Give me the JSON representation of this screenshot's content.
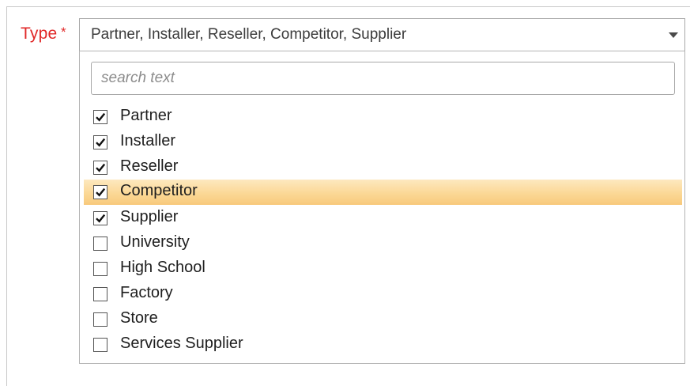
{
  "field": {
    "label": "Type",
    "required_mark": "*",
    "value": "Partner, Installer, Reseller, Competitor, Supplier"
  },
  "search": {
    "placeholder": "search text"
  },
  "options": [
    {
      "label": "Partner",
      "checked": true,
      "highlighted": false
    },
    {
      "label": "Installer",
      "checked": true,
      "highlighted": false
    },
    {
      "label": "Reseller",
      "checked": true,
      "highlighted": false
    },
    {
      "label": "Competitor",
      "checked": true,
      "highlighted": true
    },
    {
      "label": "Supplier",
      "checked": true,
      "highlighted": false
    },
    {
      "label": "University",
      "checked": false,
      "highlighted": false
    },
    {
      "label": "High School",
      "checked": false,
      "highlighted": false
    },
    {
      "label": "Factory",
      "checked": false,
      "highlighted": false
    },
    {
      "label": "Store",
      "checked": false,
      "highlighted": false
    },
    {
      "label": "Services Supplier",
      "checked": false,
      "highlighted": false
    }
  ],
  "colors": {
    "label_red": "#e02828",
    "highlight": "#fbd896"
  },
  "icons": {
    "dropdown": "chevron-down-icon",
    "check": "checkmark-icon"
  }
}
